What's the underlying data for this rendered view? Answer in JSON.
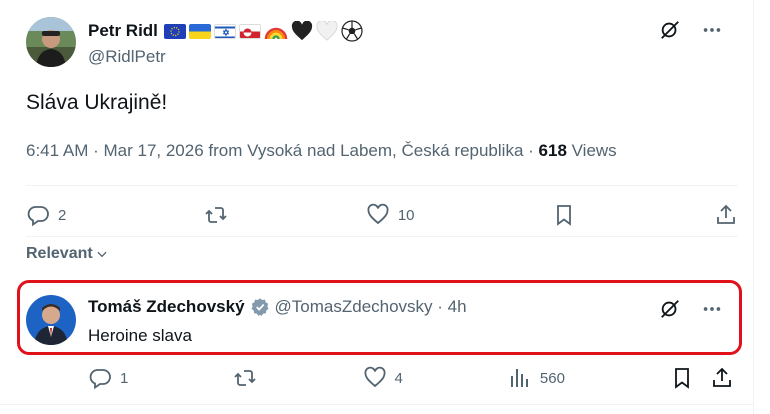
{
  "tweet": {
    "author_name": "Petr Ridl",
    "handle": "@RidlPetr",
    "text": "Sláva Ukrajině!",
    "time": "6:41 AM",
    "date": "Mar 17, 2026",
    "location": "from Vysoká nad Labem, Česká republika",
    "views_count": "618",
    "views_label": "Views",
    "replies": "2",
    "likes": "10"
  },
  "sort": {
    "label": "Relevant"
  },
  "reply": {
    "author_name": "Tomáš Zdechovský",
    "handle": "@TomasZdechovsky",
    "time": "4h",
    "text": "Heroine slava",
    "replies": "1",
    "likes": "4",
    "views": "560"
  },
  "colors": {
    "text_primary": "#0f1419",
    "text_secondary": "#536471",
    "verified": "#829aab",
    "highlight": "#e0111b"
  },
  "icons": {
    "grok": "grok-icon",
    "more": "more-icon",
    "reply": "reply-icon",
    "retweet": "retweet-icon",
    "like": "heart-icon",
    "bookmark": "bookmark-icon",
    "share": "share-icon",
    "views": "views-icon",
    "chevron": "chevron-down-icon"
  }
}
